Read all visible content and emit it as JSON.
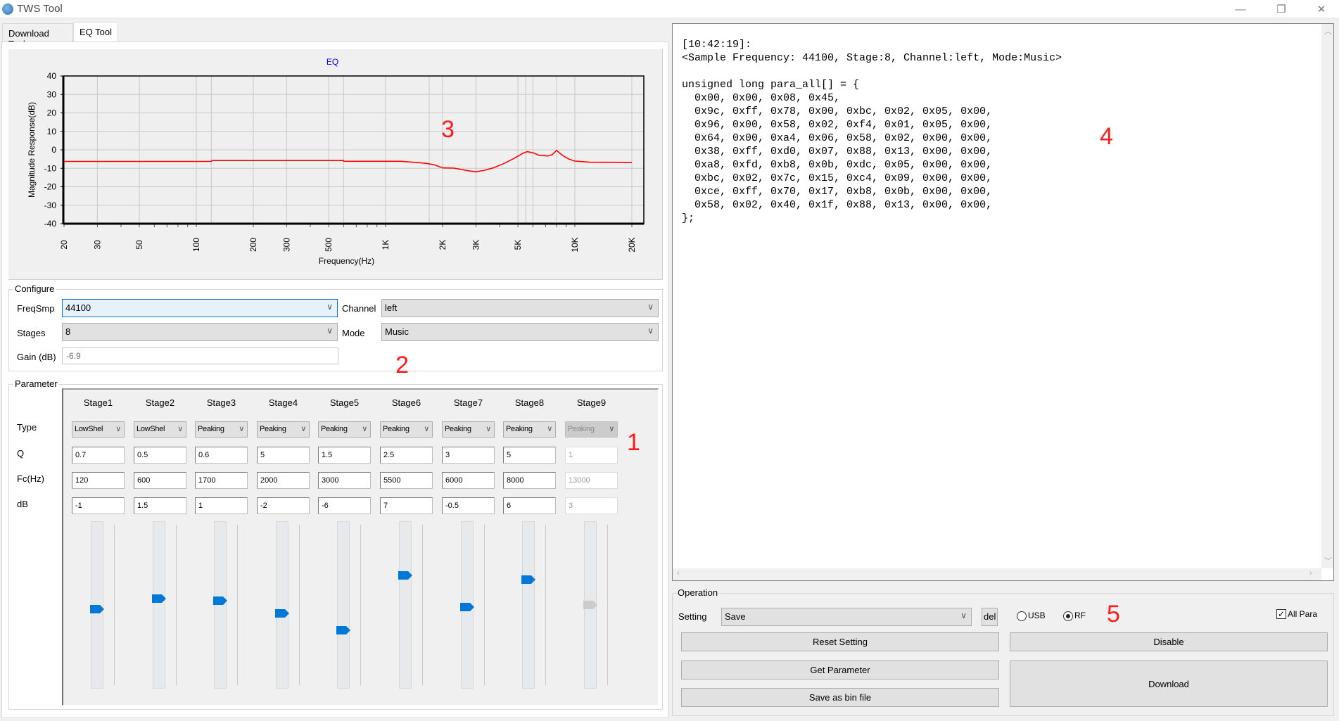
{
  "window": {
    "title": "TWS Tool",
    "controls": {
      "minimize": "—",
      "maximize": "❐",
      "close": "✕"
    }
  },
  "tabs": [
    {
      "label": "Download Tool",
      "active": false
    },
    {
      "label": "EQ Tool",
      "active": true
    }
  ],
  "chart_data": {
    "type": "line",
    "title": "EQ",
    "xlabel": "Frequency(Hz)",
    "ylabel": "Magnitude Response(dB)",
    "xscale": "log",
    "xlim": [
      20,
      22050
    ],
    "ylim": [
      -40,
      40
    ],
    "yticks": [
      40,
      30,
      20,
      10,
      0,
      -10,
      -20,
      -30,
      -40
    ],
    "xticks": [
      {
        "value": 20,
        "label": "20"
      },
      {
        "value": 30,
        "label": "30"
      },
      {
        "value": 50,
        "label": "50"
      },
      {
        "value": 100,
        "label": "100"
      },
      {
        "value": 200,
        "label": "200"
      },
      {
        "value": 300,
        "label": "300"
      },
      {
        "value": 500,
        "label": "500"
      },
      {
        "value": 1000,
        "label": "1K"
      },
      {
        "value": 2000,
        "label": "2K"
      },
      {
        "value": 3000,
        "label": "3K"
      },
      {
        "value": 5000,
        "label": "5K"
      },
      {
        "value": 10000,
        "label": "10K"
      },
      {
        "value": 20000,
        "label": "20K"
      }
    ],
    "extra_gridlines_hz": [
      120,
      600,
      1700,
      5500,
      6000,
      8000
    ],
    "grid": true,
    "series": [
      {
        "name": "EQ response",
        "color": "#ff0000",
        "points": [
          [
            20,
            -6.3
          ],
          [
            120,
            -6.3
          ],
          [
            121,
            -5.8
          ],
          [
            600,
            -5.8
          ],
          [
            601,
            -6.2
          ],
          [
            1200,
            -6.2
          ],
          [
            1350,
            -6.6
          ],
          [
            1600,
            -7.2
          ],
          [
            1800,
            -8.0
          ],
          [
            2000,
            -9.8
          ],
          [
            2300,
            -9.9
          ],
          [
            2500,
            -10.6
          ],
          [
            2800,
            -11.5
          ],
          [
            3000,
            -11.9
          ],
          [
            3300,
            -11.2
          ],
          [
            3700,
            -9.8
          ],
          [
            4200,
            -7.5
          ],
          [
            4800,
            -4.5
          ],
          [
            5300,
            -1.9
          ],
          [
            5600,
            -1.0
          ],
          [
            6000,
            -1.6
          ],
          [
            6500,
            -3.0
          ],
          [
            7200,
            -3.3
          ],
          [
            7600,
            -2.6
          ],
          [
            8000,
            -0.3
          ],
          [
            8600,
            -3.0
          ],
          [
            9300,
            -5.0
          ],
          [
            10000,
            -6.1
          ],
          [
            11000,
            -6.4
          ],
          [
            12000,
            -6.7
          ],
          [
            20000,
            -6.8
          ]
        ]
      }
    ]
  },
  "annotations": {
    "chart": "3",
    "configure": "2",
    "parameter": "1",
    "log": "4",
    "operation": "5"
  },
  "configure": {
    "title": "Configure",
    "freqsmp": {
      "label": "FreqSmp",
      "value": "44100"
    },
    "channel": {
      "label": "Channel",
      "value": "left"
    },
    "stages": {
      "label": "Stages",
      "value": "8"
    },
    "mode": {
      "label": "Mode",
      "value": "Music"
    },
    "gain": {
      "label": "Gain (dB)",
      "value": "-6.9"
    }
  },
  "parameter": {
    "title": "Parameter",
    "row_labels": {
      "type": "Type",
      "q": "Q",
      "fc": "Fc(Hz)",
      "db": "dB"
    },
    "slider_range_db": [
      -20,
      20
    ],
    "stages": [
      {
        "name": "Stage1",
        "type": "LowShel",
        "q": "0.7",
        "fc": "120",
        "db": "-1",
        "gain": -1,
        "enabled": true
      },
      {
        "name": "Stage2",
        "type": "LowShel",
        "q": "0.5",
        "fc": "600",
        "db": "1.5",
        "gain": 1.5,
        "enabled": true
      },
      {
        "name": "Stage3",
        "type": "Peaking",
        "q": "0.6",
        "fc": "1700",
        "db": "1",
        "gain": 1,
        "enabled": true
      },
      {
        "name": "Stage4",
        "type": "Peaking",
        "q": "5",
        "fc": "2000",
        "db": "-2",
        "gain": -2,
        "enabled": true
      },
      {
        "name": "Stage5",
        "type": "Peaking",
        "q": "1.5",
        "fc": "3000",
        "db": "-6",
        "gain": -6,
        "enabled": true
      },
      {
        "name": "Stage6",
        "type": "Peaking",
        "q": "2.5",
        "fc": "5500",
        "db": "7",
        "gain": 7,
        "enabled": true
      },
      {
        "name": "Stage7",
        "type": "Peaking",
        "q": "3",
        "fc": "6000",
        "db": "-0.5",
        "gain": -0.5,
        "enabled": true
      },
      {
        "name": "Stage8",
        "type": "Peaking",
        "q": "5",
        "fc": "8000",
        "db": "6",
        "gain": 6,
        "enabled": true
      },
      {
        "name": "Stage9",
        "type": "Peaking",
        "q": "1",
        "fc": "13000",
        "db": "3",
        "gain": 0,
        "enabled": false
      }
    ]
  },
  "log": {
    "lines": [
      "[10:42:19]:",
      "<Sample Frequency: 44100, Stage:8, Channel:left, Mode:Music>",
      "",
      "unsigned long para_all[] = {",
      "  0x00, 0x00, 0x08, 0x45,",
      "  0x9c, 0xff, 0x78, 0x00, 0xbc, 0x02, 0x05, 0x00,",
      "  0x96, 0x00, 0x58, 0x02, 0xf4, 0x01, 0x05, 0x00,",
      "  0x64, 0x00, 0xa4, 0x06, 0x58, 0x02, 0x00, 0x00,",
      "  0x38, 0xff, 0xd0, 0x07, 0x88, 0x13, 0x00, 0x00,",
      "  0xa8, 0xfd, 0xb8, 0x0b, 0xdc, 0x05, 0x00, 0x00,",
      "  0xbc, 0x02, 0x7c, 0x15, 0xc4, 0x09, 0x00, 0x00,",
      "  0xce, 0xff, 0x70, 0x17, 0xb8, 0x0b, 0x00, 0x00,",
      "  0x58, 0x02, 0x40, 0x1f, 0x88, 0x13, 0x00, 0x00,",
      "};"
    ]
  },
  "operation": {
    "title": "Operation",
    "setting_label": "Setting",
    "setting_value": "Save",
    "del_label": "del",
    "usb_label": "USB",
    "usb_checked": false,
    "rf_label": "RF",
    "rf_checked": true,
    "all_para_label": "All Para",
    "all_para_checked": true,
    "buttons": {
      "reset": "Reset Setting",
      "disable": "Disable",
      "get_parameter": "Get Parameter",
      "download": "Download",
      "save_bin": "Save as bin file"
    }
  },
  "colors": {
    "curve": "#ff0000",
    "slider_thumb": "#0078d7",
    "annotation": "#ff1a1a",
    "chart_title": "#0000ff"
  }
}
